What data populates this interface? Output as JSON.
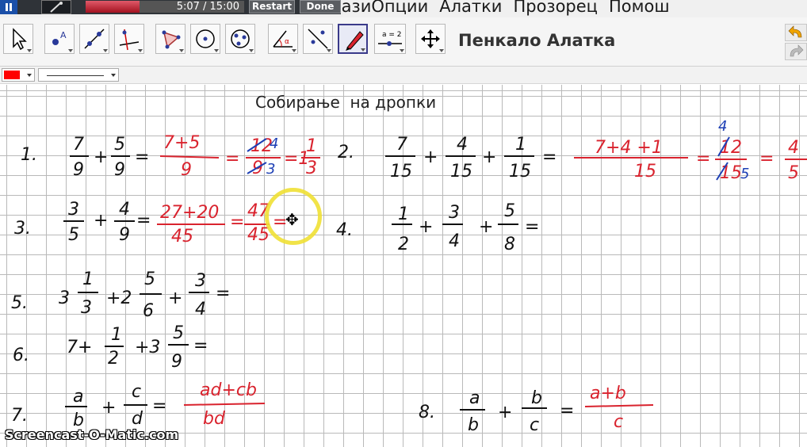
{
  "menu": {
    "items": [
      "казиОпции",
      "Алатки",
      "Прозорец",
      "Помош"
    ]
  },
  "recorder": {
    "progress_fraction": 0.34,
    "time": "5:07 / 15:00",
    "restart_label": "Restart",
    "done_label": "Done"
  },
  "toolbar": {
    "tools": [
      "move-tool-icon",
      "point-tool-icon",
      "line-tool-icon",
      "perpendicular-tool-icon",
      "polygon-tool-icon",
      "circle-tool-icon",
      "conic-tool-icon",
      "angle-tool-icon",
      "reflect-tool-icon",
      "pen-tool-icon",
      "slider-tool-icon",
      "move-graphics-view-icon"
    ],
    "selected_tool": "pen-tool-icon",
    "slider_tool_label": "a = 2",
    "active_tool_title": "Пенкало Алатка",
    "undo_icon": "undo-icon",
    "redo_icon": "redo-icon"
  },
  "stylebar": {
    "pen_color": "#ff0000",
    "line_style": "solid"
  },
  "canvas": {
    "title": "Собирање  на дропки",
    "ink_color_black": "#111111",
    "ink_color_red": "#d9232e",
    "ink_color_blue": "#1d3fb5",
    "problems": [
      {
        "number": "1.",
        "expression": "7/9 + 5/9 =",
        "work": "7+5 / 9 = 12/9 = 1 1/3",
        "simplified": "12 4 / 9 3"
      },
      {
        "number": "2.",
        "expression": "7/15 + 4/15 + 1/15 =",
        "work": "7+4+1 / 15 = 12/15 = 4/5",
        "simplified": "4 / 5"
      },
      {
        "number": "3.",
        "expression": "3/5 + 4/9 =",
        "work": "27+20 / 45 = 47/45 ="
      },
      {
        "number": "4.",
        "expression": "1/2 + 3/4 + 5/8 ="
      },
      {
        "number": "5.",
        "expression": "3 1/3 + 2 5/6 + 3/4 ="
      },
      {
        "number": "6.",
        "expression": "7 + 1/2 + 3 5/9 ="
      },
      {
        "number": "7.",
        "expression": "a/b + c/d =",
        "work": "ad+cb / bd"
      },
      {
        "number": "8.",
        "expression": "a/b + b/c =",
        "work": "a+b / c"
      }
    ]
  },
  "watermark": "Screencast-O-Matic.com"
}
